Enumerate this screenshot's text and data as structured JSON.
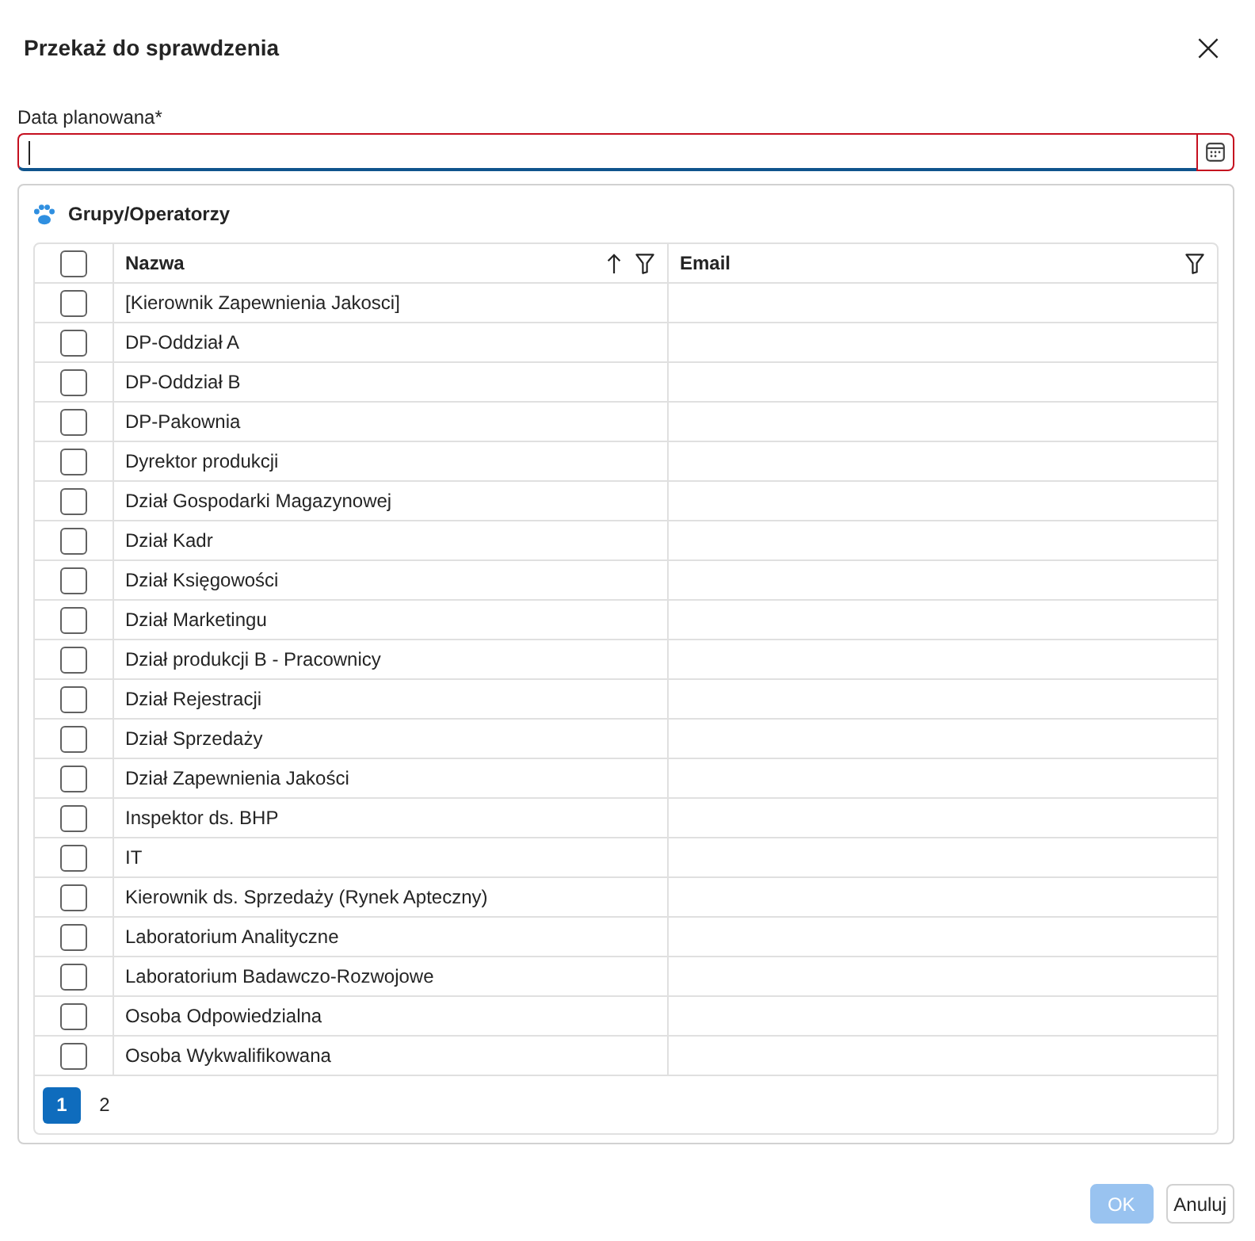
{
  "dialog": {
    "title": "Przekaż do sprawdzenia"
  },
  "date_field": {
    "label": "Data planowana*",
    "invalid": true,
    "focused": true
  },
  "group_panel": {
    "title": "Grupy/Operatorzy"
  },
  "table": {
    "select_all": {
      "checked": false
    },
    "columns": [
      {
        "label": "Nazwa",
        "sorted": true
      },
      {
        "label": "Email",
        "sorted": false
      }
    ],
    "rows": [
      {
        "name": "[Kierownik Zapewnienia Jakosci]",
        "checked": false
      },
      {
        "name": "DP-Oddział A",
        "checked": false
      },
      {
        "name": "DP-Oddział B",
        "checked": false
      },
      {
        "name": "DP-Pakownia",
        "checked": false
      },
      {
        "name": "Dyrektor produkcji",
        "checked": false
      },
      {
        "name": "Dział Gospodarki Magazynowej",
        "checked": false
      },
      {
        "name": "Dział Kadr",
        "checked": false
      },
      {
        "name": "Dział Księgowości",
        "checked": false
      },
      {
        "name": "Dział Marketingu",
        "checked": false
      },
      {
        "name": "Dział produkcji B - Pracownicy",
        "checked": false
      },
      {
        "name": "Dział Rejestracji",
        "checked": false
      },
      {
        "name": "Dział Sprzedaży",
        "checked": false
      },
      {
        "name": "Dział Zapewnienia Jakości",
        "checked": false
      },
      {
        "name": "Inspektor ds. BHP",
        "checked": false
      },
      {
        "name": "IT",
        "checked": false
      },
      {
        "name": "Kierownik ds. Sprzedaży (Rynek Apteczny)",
        "checked": false
      },
      {
        "name": "Laboratorium Analityczne",
        "checked": false
      },
      {
        "name": "Laboratorium Badawczo-Rozwojowe",
        "checked": false
      },
      {
        "name": "Osoba Odpowiedzialna",
        "checked": false
      },
      {
        "name": "Osoba Wykwalifikowana",
        "checked": false
      }
    ]
  },
  "pagination": [
    {
      "label": "1",
      "selected": true
    },
    {
      "label": "2",
      "selected": false
    }
  ],
  "buttons": [
    {
      "label": "OK",
      "kind": "primary",
      "disabled": true
    },
    {
      "label": "Anuluj",
      "kind": "secondary",
      "disabled": false
    }
  ]
}
